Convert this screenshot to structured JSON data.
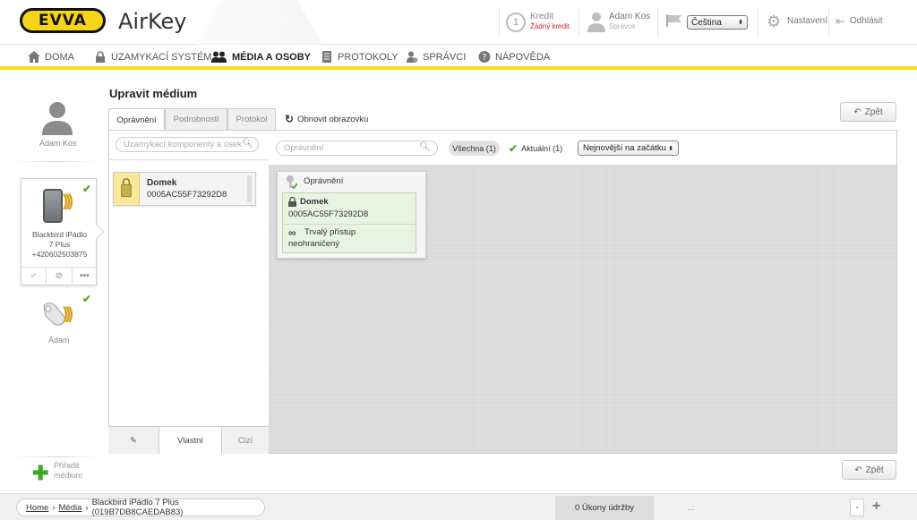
{
  "header": {
    "logo": "EVVA",
    "brand": "AirKey",
    "credit_label": "Kredit",
    "credit_value": "Žádný kredit",
    "user_name": "Adam Kos",
    "user_role": "Správce",
    "language": "Čeština",
    "settings": "Nastavení",
    "logout": "Odhlásit"
  },
  "nav": {
    "items": [
      {
        "label": "DOMA",
        "icon": "home-icon"
      },
      {
        "label": "UZAMYKACÍ SYSTÉM",
        "icon": "lock-icon"
      },
      {
        "label": "MÉDIA A OSOBY",
        "icon": "people-icon"
      },
      {
        "label": "PROTOKOLY",
        "icon": "document-icon"
      },
      {
        "label": "SPRÁVCI",
        "icon": "admin-icon"
      },
      {
        "label": "NÁPOVĚDA",
        "icon": "help-icon"
      }
    ],
    "active_index": 2
  },
  "left": {
    "person_name": "Adam Kos",
    "media": {
      "name_line1": "Blackbird iPádlo",
      "name_line2": "7 Plus",
      "phone": "+420602503875"
    },
    "tag_name": "Adam",
    "assign_line1": "Přiřadit",
    "assign_line2": "médium"
  },
  "page": {
    "title": "Upravit médium",
    "back_label": "Zpět",
    "tabs": [
      "Oprávnění",
      "Podrobnosti",
      "Protokol"
    ],
    "active_tab": 0,
    "refresh_label": "Obnovit obrazovku"
  },
  "components": {
    "search_placeholder": "Uzamykací komponenty a úsek",
    "item_name": "Domek",
    "item_id": "0005AC55F73292D8",
    "footer_tabs": [
      "Vlastní",
      "Cizí"
    ]
  },
  "authorizations": {
    "search_placeholder": "Oprávnění",
    "filter_all": "Všechna (1)",
    "filter_current": "Aktuální (1)",
    "sort": "Nejnovější na začátku",
    "card_title": "Oprávnění",
    "entry_name": "Domek",
    "entry_id": "0005AC55F73292D8",
    "access_type": "Trvalý přístup",
    "access_limit": "neohraničený"
  },
  "footer": {
    "breadcrumb_home": "Home",
    "breadcrumb_media": "Média",
    "breadcrumb_current": "Blackbird iPádlo 7 Plus (019B7DB8CAEDAB83)",
    "maintenance": "0 Úkony údržby",
    "dots": "...",
    "minus": "-",
    "plus": "+"
  },
  "colors": {
    "accent_yellow": "#f5dc1a",
    "success_green": "#55b02b",
    "alert_red": "#d9262b"
  }
}
